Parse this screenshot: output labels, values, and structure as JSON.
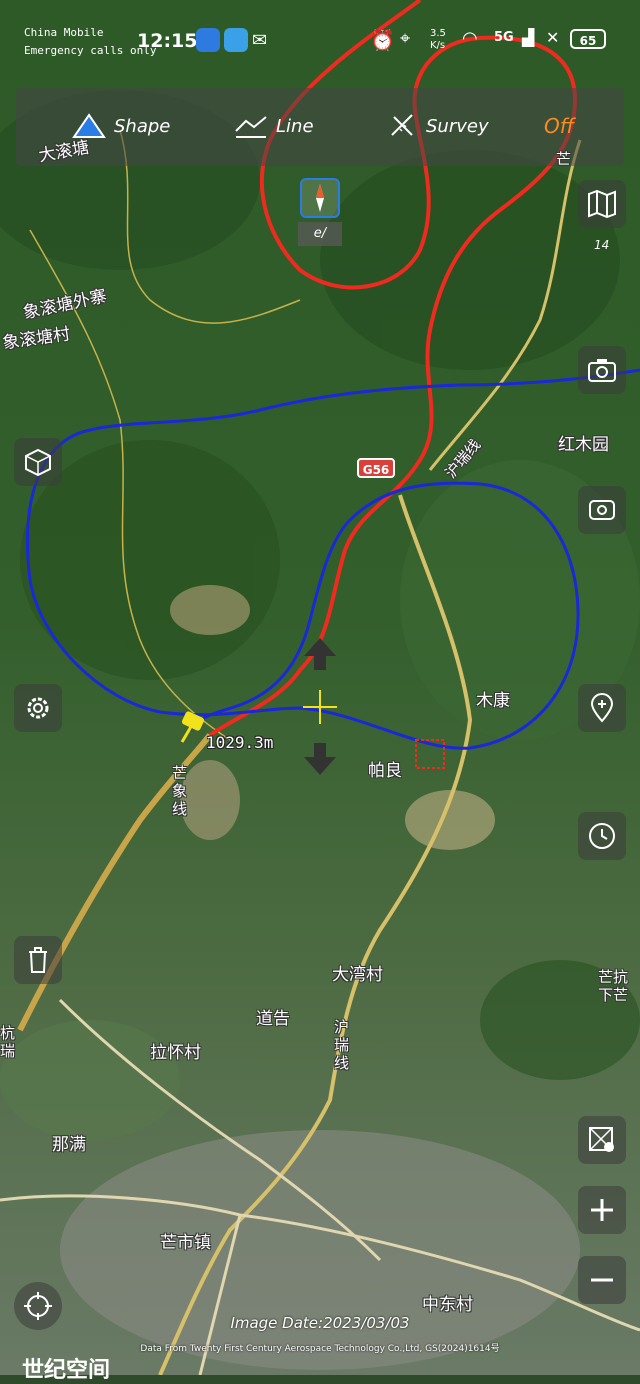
{
  "status_bar": {
    "carrier": "China Mobile",
    "emergency": "Emergency calls only",
    "time": "12:15",
    "net_speed": "3.5",
    "net_speed_unit": "K/s",
    "network": "5G",
    "battery": "65"
  },
  "toolbar": {
    "shape_label": "Shape",
    "line_label": "Line",
    "survey_label": "Survey",
    "toggle_label": "Off"
  },
  "compass": {
    "label": "e/"
  },
  "zoom_level": "14",
  "map_labels": {
    "dalangtang": "大滚塘",
    "xianglangtang_outer": "象滚塘外寨",
    "xianglangtang_village": "象滚塘村",
    "hongmuyuan": "红木园",
    "hurui_top": "沪瑞线",
    "mukang": "木康",
    "paliang": "帕良",
    "mangxiang": "芒象线",
    "dawan": "大湾村",
    "daogao": "道告",
    "lahuai": "拉怀村",
    "nuoman": "那满",
    "hurui_mid": "沪瑞线",
    "mangshi": "芒市镇",
    "zhongdong": "中东村",
    "hang": "杭瑞",
    "right_edge": "芒抗下芒",
    "top_right": "芒"
  },
  "road_shield": "G56",
  "distance": "1029.3m",
  "image_date": "Image Date:2023/03/03",
  "attribution": "Data From Twenty First Century Aerospace Technology Co.,Ltd, GS(2024)1614号",
  "watermark": "世纪空间",
  "colors": {
    "blue_path": "#1a28d9",
    "red_path": "#ef2a1e",
    "accent": "#2a7ce6",
    "toggle": "#ff8a1e",
    "pin": "#f2e21a"
  }
}
